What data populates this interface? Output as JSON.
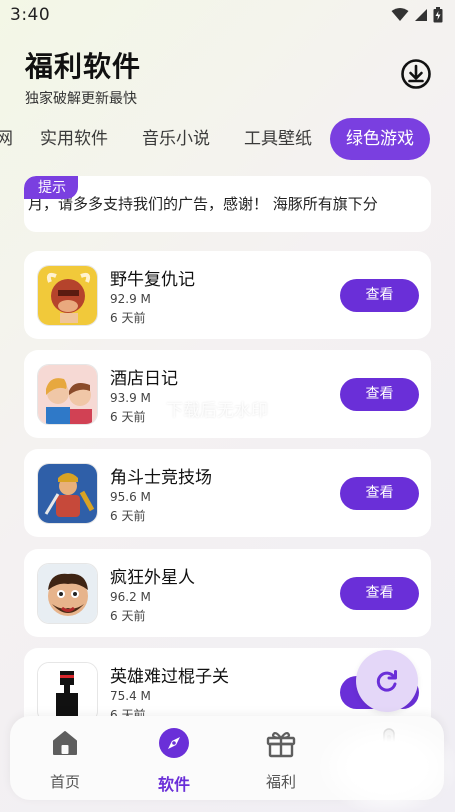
{
  "status_bar": {
    "time": "3:40"
  },
  "header": {
    "title": "福利软件",
    "subtitle": "独家破解更新最快"
  },
  "tabs": [
    {
      "label": "网"
    },
    {
      "label": "实用软件"
    },
    {
      "label": "音乐小说"
    },
    {
      "label": "工具壁纸"
    },
    {
      "label": "绿色游戏",
      "active": true
    }
  ],
  "notice": {
    "tag": "提示",
    "text": "月，请多多支持我们的广告，感谢！   海豚所有旗下分"
  },
  "apps": [
    {
      "name": "野牛复仇记",
      "size": "92.9 M",
      "date": "6 天前",
      "button": "查看",
      "icon": "bull-game-icon"
    },
    {
      "name": "酒店日记",
      "size": "93.9 M",
      "date": "6 天前",
      "button": "查看",
      "icon": "hotel-game-icon"
    },
    {
      "name": "角斗士竞技场",
      "size": "95.6 M",
      "date": "6 天前",
      "button": "查看",
      "icon": "gladiator-game-icon"
    },
    {
      "name": "疯狂外星人",
      "size": "96.2 M",
      "date": "6 天前",
      "button": "查看",
      "icon": "alien-game-icon"
    },
    {
      "name": "英雄难过棍子关",
      "size": "75.4 M",
      "date": "6 天前",
      "button": "查看",
      "icon": "stick-hero-game-icon"
    }
  ],
  "watermark": "下载后无水印",
  "bottom_nav": [
    {
      "label": "首页",
      "icon": "home-icon"
    },
    {
      "label": "软件",
      "icon": "compass-icon",
      "active": true
    },
    {
      "label": "福利",
      "icon": "gift-icon"
    }
  ],
  "colors": {
    "accent": "#6a2fd8",
    "tab_active": "#7a3fe0",
    "fab_bg": "#e4d7f8"
  }
}
